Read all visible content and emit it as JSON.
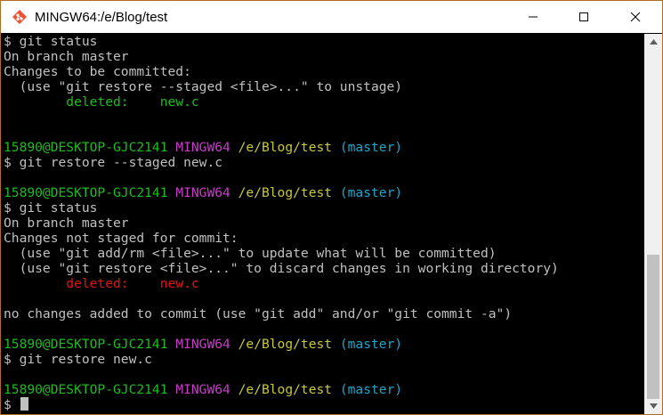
{
  "window": {
    "title": "MINGW64:/e/Blog/test",
    "icon": "git-bash-icon",
    "controls": [
      "minimize-icon",
      "maximize-icon",
      "close-icon"
    ]
  },
  "colors": {
    "prompt_user": "#1fbb1f",
    "prompt_system": "#c83cc8",
    "prompt_path": "#c8c83a",
    "prompt_branch": "#1ea5c8",
    "staged": "#1fbb1f",
    "unstaged": "#e01414",
    "text": "#c0c0c0"
  },
  "terminal": {
    "lines": [
      {
        "type": "plain",
        "text": "$ git status"
      },
      {
        "type": "plain",
        "text": "On branch master"
      },
      {
        "type": "plain",
        "text": "Changes to be committed:"
      },
      {
        "type": "plain",
        "text": "  (use \"git restore --staged <file>...\" to unstage)"
      },
      {
        "type": "colored",
        "color": "green",
        "text": "        deleted:    new.c"
      },
      {
        "type": "blank",
        "text": ""
      },
      {
        "type": "blank",
        "text": ""
      },
      {
        "type": "prompt",
        "user": "15890@DESKTOP-GJC2141",
        "system": "MINGW64",
        "path": "/e/Blog/test",
        "branch": "(master)"
      },
      {
        "type": "plain",
        "text": "$ git restore --staged new.c"
      },
      {
        "type": "blank",
        "text": ""
      },
      {
        "type": "prompt",
        "user": "15890@DESKTOP-GJC2141",
        "system": "MINGW64",
        "path": "/e/Blog/test",
        "branch": "(master)"
      },
      {
        "type": "plain",
        "text": "$ git status"
      },
      {
        "type": "plain",
        "text": "On branch master"
      },
      {
        "type": "plain",
        "text": "Changes not staged for commit:"
      },
      {
        "type": "plain",
        "text": "  (use \"git add/rm <file>...\" to update what will be committed)"
      },
      {
        "type": "plain",
        "text": "  (use \"git restore <file>...\" to discard changes in working directory)"
      },
      {
        "type": "colored",
        "color": "red",
        "text": "        deleted:    new.c"
      },
      {
        "type": "blank",
        "text": ""
      },
      {
        "type": "plain",
        "text": "no changes added to commit (use \"git add\" and/or \"git commit -a\")"
      },
      {
        "type": "blank",
        "text": ""
      },
      {
        "type": "prompt",
        "user": "15890@DESKTOP-GJC2141",
        "system": "MINGW64",
        "path": "/e/Blog/test",
        "branch": "(master)"
      },
      {
        "type": "plain",
        "text": "$ git restore new.c"
      },
      {
        "type": "blank",
        "text": ""
      },
      {
        "type": "prompt",
        "user": "15890@DESKTOP-GJC2141",
        "system": "MINGW64",
        "path": "/e/Blog/test",
        "branch": "(master)"
      },
      {
        "type": "input",
        "text": "$ "
      }
    ]
  },
  "scrollbar": {
    "up_icon": "scroll-up-arrow-icon",
    "down_icon": "scroll-down-arrow-icon"
  }
}
